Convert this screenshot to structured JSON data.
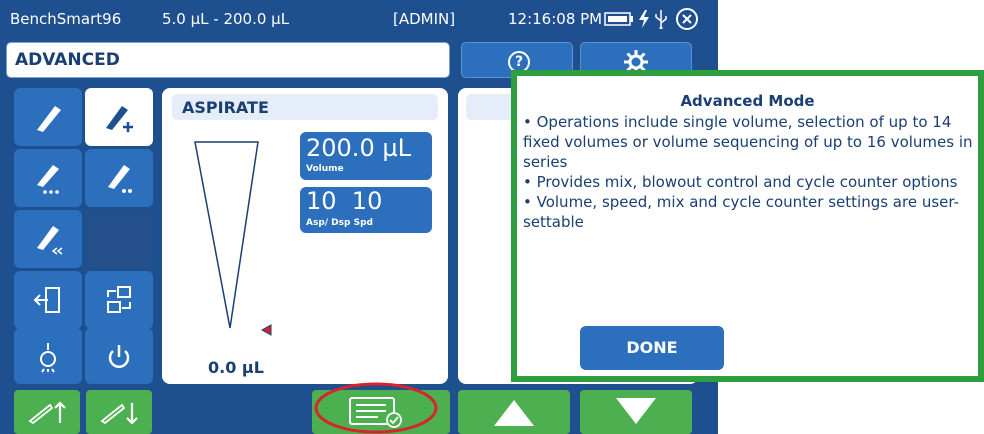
{
  "status": {
    "device": "BenchSmart96",
    "range": "5.0 µL - 200.0 µL",
    "user": "[ADMIN]",
    "time": "12:16:08 PM"
  },
  "header": {
    "mode": "ADVANCED",
    "help_glyph": "?"
  },
  "panel": {
    "title": "ASPIRATE",
    "volume_value": "200.0 µL",
    "volume_label": "Volume",
    "speed_value": "10  10",
    "speed_label": "Asp/ Dsp Spd",
    "current_volume": "0.0 µL"
  },
  "dialog": {
    "title": "Advanced Mode",
    "items": [
      "• Operations include single volume, selection of up to 14 fixed volumes or volume sequencing of up to 16 volumes in series",
      "• Provides mix, blowout control and cycle counter options",
      "• Volume, speed, mix and cycle counter settings are user-settable"
    ],
    "done_label": "DONE"
  },
  "colors": {
    "device_bg": "#1e4f8e",
    "button_blue": "#2c6fbd",
    "accent_green": "#4caf50",
    "dialog_border": "#2e9e3e",
    "highlight_red": "#d8232a"
  },
  "icons": [
    "pipette-icon",
    "pipette-plus-icon",
    "pipette-drops-icon",
    "pipette-drops-alt-icon",
    "pipette-rewind-icon",
    "exit-icon",
    "transfer-icon",
    "light-bulb-icon",
    "power-icon",
    "tip-up-icon",
    "tip-down-icon",
    "checklist-icon",
    "arrow-up-icon",
    "arrow-down-icon",
    "gear-icon",
    "battery-icon",
    "lightning-icon",
    "usb-icon",
    "close-icon"
  ]
}
